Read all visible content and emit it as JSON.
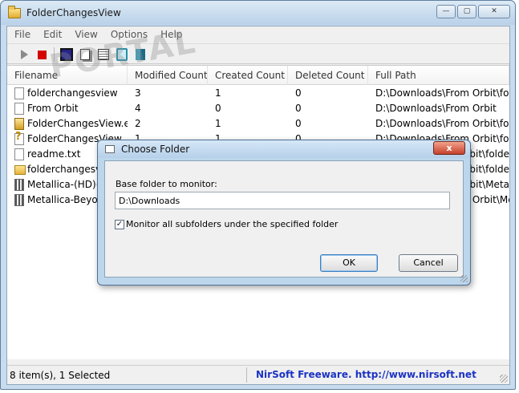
{
  "window": {
    "title": "FolderChangesView",
    "controls": {
      "minimize": "—",
      "maximize": "▢",
      "close": "✕"
    }
  },
  "menu": [
    "File",
    "Edit",
    "View",
    "Options",
    "Help"
  ],
  "toolbar": {
    "buttons": [
      "play-icon",
      "stop-icon",
      "save-icon",
      "copy-icon",
      "properties-icon",
      "find-icon",
      "exit-icon"
    ]
  },
  "watermark": "PORTAL",
  "list": {
    "columns": [
      "Filename",
      "Modified Count",
      "Created Count",
      "Deleted Count",
      "Full Path"
    ],
    "rows": [
      {
        "icon": "doc",
        "filename": "folderchangesview",
        "modified": "3",
        "created": "1",
        "deleted": "0",
        "path": "D:\\Downloads\\From Orbit\\folde"
      },
      {
        "icon": "doc",
        "filename": "From Orbit",
        "modified": "4",
        "created": "0",
        "deleted": "0",
        "path": "D:\\Downloads\\From Orbit"
      },
      {
        "icon": "exe",
        "filename": "FolderChangesView.exe",
        "modified": "2",
        "created": "1",
        "deleted": "0",
        "path": "D:\\Downloads\\From Orbit\\folde"
      },
      {
        "icon": "warn",
        "filename": "FolderChangesView",
        "modified": "1",
        "created": "1",
        "deleted": "0",
        "path": "D:\\Downloads\\From Orbit\\folde"
      },
      {
        "icon": "doc",
        "filename": "readme.txt",
        "modified": "",
        "created": "",
        "deleted": "",
        "path": "From Orbit\\folde"
      },
      {
        "icon": "folder",
        "filename": "folderchangesview",
        "modified": "",
        "created": "",
        "deleted": "",
        "path": "From Orbit\\folde"
      },
      {
        "icon": "media",
        "filename": "Metallica-(HD)(L",
        "modified": "",
        "created": "",
        "deleted": "",
        "path": "From Orbit\\Meta"
      },
      {
        "icon": "media",
        "filename": "Metallica-Beyond",
        "modified": "",
        "created": "",
        "deleted": "",
        "path": "D:\\Downloads\\From Orbit\\Meta"
      }
    ]
  },
  "scrollbar": {
    "left_arrow": "◀",
    "right_arrow": "▶",
    "thumb_grip": "|||"
  },
  "status": {
    "items": "8 item(s), 1 Selected",
    "credit": "NirSoft Freeware.  http://www.nirsoft.net"
  },
  "dialog": {
    "title": "Choose Folder",
    "close_label": "x",
    "base_label": "Base folder to monitor:",
    "base_value": "D:\\Downloads",
    "subfolders_checked": true,
    "check_mark": "✓",
    "subfolders_label": "Monitor all subfolders under the specified folder",
    "ok_label": "OK",
    "cancel_label": "Cancel"
  }
}
